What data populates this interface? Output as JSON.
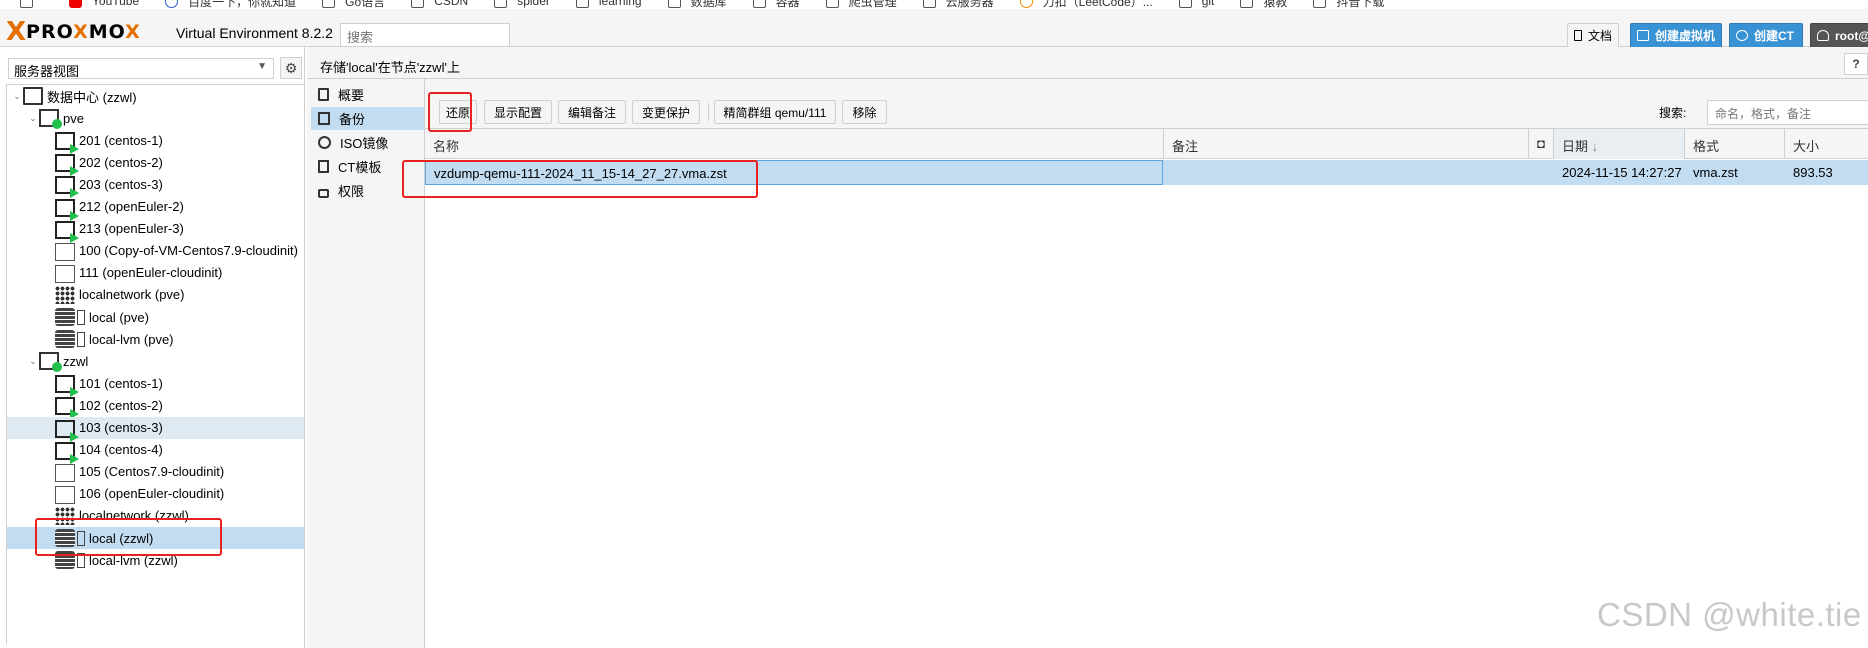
{
  "bookmarks": [
    "YouTube",
    "百度一下，你就知道",
    "Go语言",
    "CSDN",
    "spider",
    "learning",
    "数据库",
    "容器",
    "爬虫管理",
    "云服务器",
    "力扣（LeetCode）...",
    "git",
    "猿教",
    "抖音下载"
  ],
  "header": {
    "logo_x": "X",
    "logo_pro": "PRO",
    "logo_x2": "X",
    "logo_mo": "MO",
    "logo_x3": "X",
    "version": "Virtual Environment 8.2.2",
    "search_placeholder": "搜索",
    "docs_label": "文档",
    "create_vm_label": "创建虚拟机",
    "create_ct_label": "创建CT",
    "user_label": "root@"
  },
  "tree": {
    "view_selector": "服务器视图",
    "nodes": [
      {
        "label": "数据中心 (zzwl)",
        "icon": "datacenter-icon"
      },
      {
        "label": "pve",
        "icon": "node-icon"
      },
      {
        "label": "201 (centos-1)",
        "icon": "vm-running-icon"
      },
      {
        "label": "202 (centos-2)",
        "icon": "vm-running-icon"
      },
      {
        "label": "203 (centos-3)",
        "icon": "vm-running-icon"
      },
      {
        "label": "212 (openEuler-2)",
        "icon": "vm-running-icon"
      },
      {
        "label": "213 (openEuler-3)",
        "icon": "vm-running-icon"
      },
      {
        "label": "100 (Copy-of-VM-Centos7.9-cloudinit)",
        "icon": "template-icon"
      },
      {
        "label": "111 (openEuler-cloudinit)",
        "icon": "template-icon"
      },
      {
        "label": "localnetwork (pve)",
        "icon": "network-icon"
      },
      {
        "label": "local (pve)",
        "icon": "storage-icon"
      },
      {
        "label": "local-lvm (pve)",
        "icon": "storage-icon"
      },
      {
        "label": "zzwl",
        "icon": "node-icon"
      },
      {
        "label": "101 (centos-1)",
        "icon": "vm-running-icon"
      },
      {
        "label": "102 (centos-2)",
        "icon": "vm-running-icon"
      },
      {
        "label": "103 (centos-3)",
        "icon": "vm-running-icon"
      },
      {
        "label": "104 (centos-4)",
        "icon": "vm-running-icon"
      },
      {
        "label": "105 (Centos7.9-cloudinit)",
        "icon": "template-icon"
      },
      {
        "label": "106 (openEuler-cloudinit)",
        "icon": "template-icon"
      },
      {
        "label": "localnetwork (zzwl)",
        "icon": "network-icon"
      },
      {
        "label": "local (zzwl)",
        "icon": "storage-icon"
      },
      {
        "label": "local-lvm (zzwl)",
        "icon": "storage-icon"
      }
    ]
  },
  "content": {
    "title": "存储'local'在节点'zzwl'上",
    "subnav": [
      "概要",
      "备份",
      "ISO镜像",
      "CT模板",
      "权限"
    ],
    "toolbar": {
      "restore": "还原",
      "show_config": "显示配置",
      "edit_notes": "编辑备注",
      "change_protection": "变更保护",
      "prune_group": "精简群组 qemu/111",
      "remove": "移除",
      "search_label": "搜索:",
      "search_placeholder": "命名，格式，备注"
    },
    "columns": {
      "name": "名称",
      "notes": "备注",
      "date": "日期",
      "format": "格式",
      "size": "大小"
    },
    "rows": [
      {
        "name": "vzdump-qemu-111-2024_11_15-14_27_27.vma.zst",
        "notes": "",
        "date": "2024-11-15 14:27:27",
        "format": "vma.zst",
        "size": "893.53"
      }
    ]
  },
  "watermark": "CSDN @white.tie",
  "colors": {
    "accent": "#3892d4",
    "selection": "#c2ddf2",
    "brand_orange": "#e57000",
    "annotation": "#e8231f"
  }
}
